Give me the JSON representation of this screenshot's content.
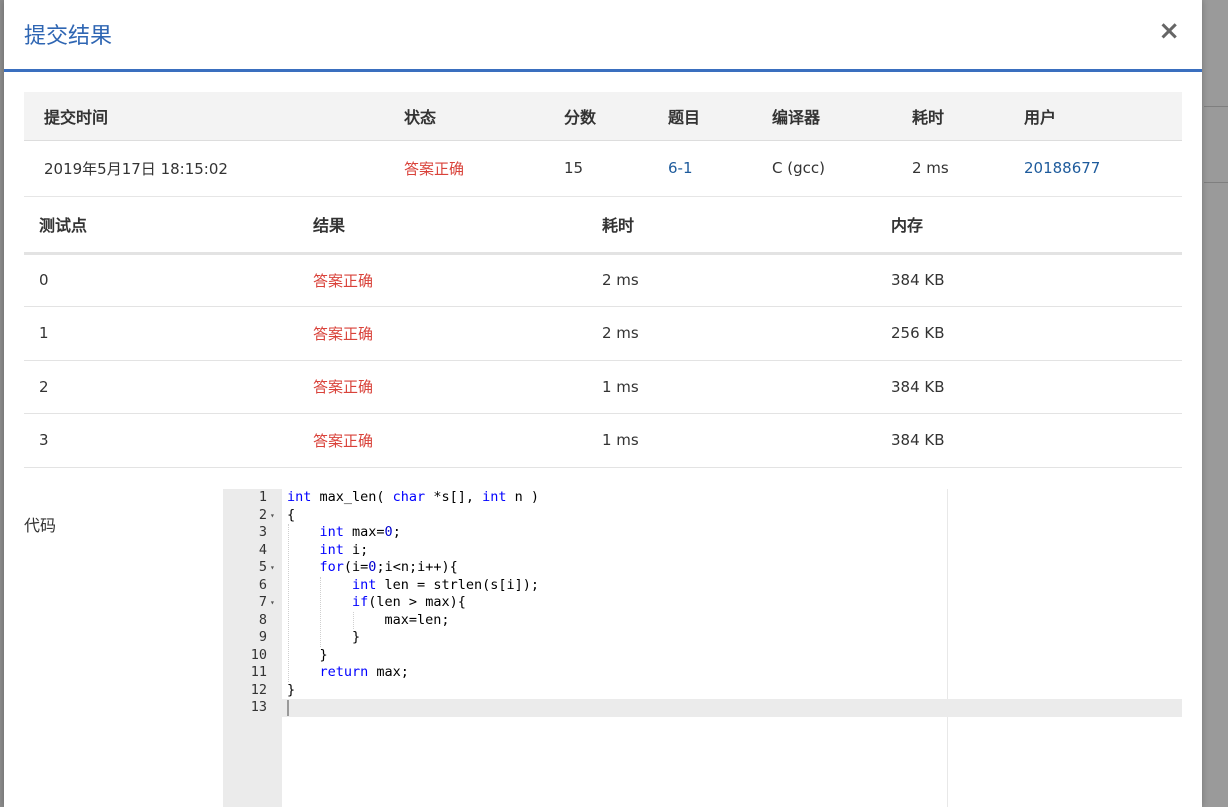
{
  "modal": {
    "title": "提交结果",
    "close_label": "×"
  },
  "submission": {
    "headers": [
      "提交时间",
      "状态",
      "分数",
      "题目",
      "编译器",
      "耗时",
      "用户"
    ],
    "row": {
      "time": "2019年5月17日 18:15:02",
      "status": "答案正确",
      "score": "15",
      "problem": "6-1",
      "compiler": "C (gcc)",
      "elapsed": "2 ms",
      "user": "20188677"
    }
  },
  "tests": {
    "headers": [
      "测试点",
      "结果",
      "耗时",
      "内存"
    ],
    "rows": [
      {
        "id": "0",
        "result": "答案正确",
        "time": "2 ms",
        "memory": "384 KB"
      },
      {
        "id": "1",
        "result": "答案正确",
        "time": "2 ms",
        "memory": "256 KB"
      },
      {
        "id": "2",
        "result": "答案正确",
        "time": "1 ms",
        "memory": "384 KB"
      },
      {
        "id": "3",
        "result": "答案正确",
        "time": "1 ms",
        "memory": "384 KB"
      }
    ]
  },
  "code": {
    "label": "代码",
    "lines": [
      "int max_len( char *s[], int n )",
      "{",
      "    int max=0;",
      "    int i;",
      "    for(i=0;i<n;i++){",
      "        int len = strlen(s[i]);",
      "        if(len > max){",
      "            max=len;",
      "        }",
      "    }",
      "    return max;",
      "}",
      ""
    ],
    "line_numbers": [
      "1",
      "2",
      "3",
      "4",
      "5",
      "6",
      "7",
      "8",
      "9",
      "10",
      "11",
      "12",
      "13"
    ],
    "fold_markers": [
      "",
      "▾",
      "",
      "",
      "▾",
      "",
      "▾",
      "",
      "",
      "",
      "",
      "",
      ""
    ],
    "active_line": 13
  },
  "colors": {
    "accent": "#2f66b3",
    "accepted": "#d9423a",
    "link": "#1e5b9c"
  }
}
